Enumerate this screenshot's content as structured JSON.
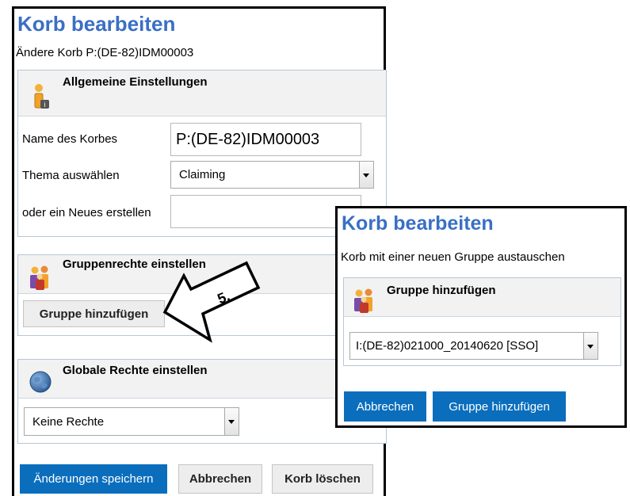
{
  "main": {
    "title": "Korb bearbeiten",
    "subtitle": "Ändere Korb P:(DE-82)IDM00003",
    "general": {
      "title": "Allgemeine Einstellungen",
      "icon": "user-info-icon",
      "name_label": "Name des Korbes",
      "name_value": "P:(DE-82)IDM00003",
      "topic_label": "Thema auswählen",
      "topic_value": "Claiming",
      "new_label": "oder ein Neues erstellen",
      "new_value": ""
    },
    "group": {
      "title": "Gruppenrechte einstellen",
      "icon": "group-icon",
      "button": "Gruppe hinzufügen"
    },
    "global": {
      "title": "Globale Rechte einstellen",
      "icon": "globe-icon",
      "select_value": "Keine Rechte"
    },
    "buttons": {
      "save": "Änderungen speichern",
      "cancel": "Abbrechen",
      "delete": "Korb löschen"
    }
  },
  "callout": {
    "label": "5."
  },
  "dialog": {
    "title": "Korb bearbeiten",
    "subtitle": "Korb mit einer neuen Gruppe austauschen",
    "section_title": "Gruppe hinzufügen",
    "section_icon": "group-icon",
    "select_value": "I:(DE-82)021000_20140620 [SSO]",
    "buttons": {
      "cancel": "Abbrechen",
      "add": "Gruppe hinzufügen"
    }
  },
  "colors": {
    "title": "#3a6fc4",
    "primary_button": "#0a6ebd",
    "section_header": "#f2f2f2",
    "section_border": "#b7c6d6"
  }
}
